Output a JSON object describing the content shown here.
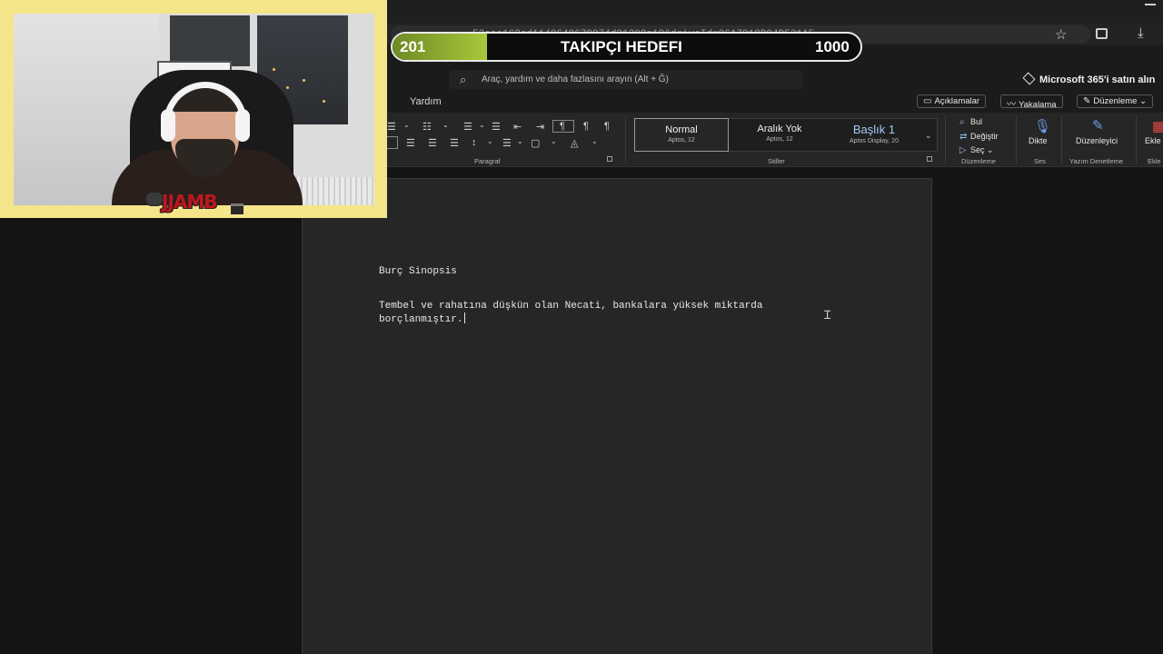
{
  "browser": {
    "address_fragment": "52eae162ed1148648679974d21309a19&driveId=96A7918D94D531A5",
    "icons": [
      "star-icon",
      "extensions-icon",
      "download-icon",
      "folder-icon",
      "minimize-icon"
    ]
  },
  "goal": {
    "current": "201",
    "title": "TAKIPÇI HEDEFI",
    "target": "1000",
    "progress_fraction": 0.201,
    "fill_color": "#a7c83b"
  },
  "word": {
    "search_placeholder": "Araç, yardım ve daha fazlasını arayın (Alt + Ğ)",
    "m365_label": "Microsoft 365'i satın alın",
    "tab_help": "Yardım",
    "btn_comments": "Açıklamalar",
    "btn_catchup": "Yakalama",
    "btn_editing": "Düzenleme",
    "group_paragraph": "Paragraf",
    "group_styles": "Stiller",
    "group_editing": "Düzenleme",
    "group_voice": "Ses",
    "group_proofing": "Yazım Denetleme",
    "group_addins": "Ekle",
    "styles": [
      {
        "name": "Normal",
        "font": "Aptos, 12"
      },
      {
        "name": "Aralık Yok",
        "font": "Aptos, 12"
      },
      {
        "name": "Başlık 1",
        "font": "Aptos Display, 20"
      }
    ],
    "edit_find": "Bul",
    "edit_replace": "Değiştir",
    "edit_select": "Seç",
    "dictate": "Dikte",
    "editor": "Düzenleyici",
    "addins": "Ekle"
  },
  "document": {
    "title": "Burç Sinopsis",
    "paragraph": "Tembel ve rahatına düşkün olan Necati, bankalara yüksek miktarda borçlanmıştır."
  },
  "webcam": {
    "overlay_logo": "JJAMB",
    "frame_color": "#f5e58a"
  }
}
